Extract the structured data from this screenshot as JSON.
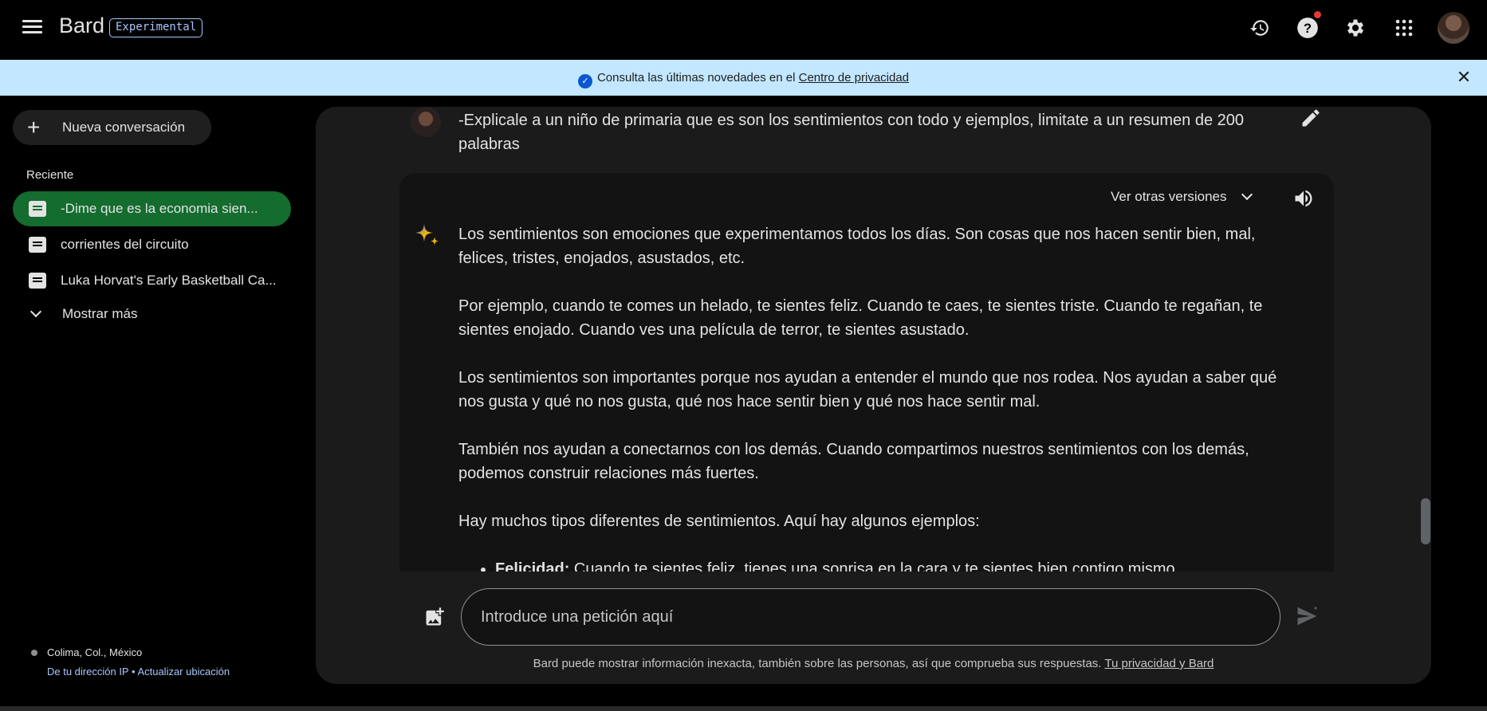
{
  "header": {
    "brand": "Bard",
    "badge": "Experimental",
    "icons": [
      "menu-icon",
      "history-icon",
      "help-icon",
      "settings-icon",
      "apps-icon",
      "avatar"
    ]
  },
  "banner": {
    "text": "Consulta las últimas novedades en el ",
    "link": "Centro de privacidad",
    "icons": [
      "verified-check-icon",
      "close-icon"
    ]
  },
  "sidebar": {
    "new_chat_label": "Nueva conversación",
    "recent_heading": "Reciente",
    "conversations": [
      {
        "title": "-Dime que es la economia sien...",
        "active": true
      },
      {
        "title": "corrientes del circuito",
        "active": false
      },
      {
        "title": "Luka Horvat's Early Basketball Ca...",
        "active": false
      }
    ],
    "show_more_label": "Mostrar más",
    "location": {
      "place": "Colima, Col., México",
      "ip_link": "De tu dirección IP",
      "separator": " • ",
      "update_link": "Actualizar ubicación"
    }
  },
  "chat": {
    "user_prompt": "-Explicale a un niño de primaria que es son los sentimientos con todo y ejemplos, limitate a un resumen de 200 palabras",
    "versions_label": "Ver otras versiones",
    "response": {
      "paragraphs": [
        "Los sentimientos son emociones que experimentamos todos los días. Son cosas que nos hacen sentir bien, mal, felices, tristes, enojados, asustados, etc.",
        "Por ejemplo, cuando te comes un helado, te sientes feliz. Cuando te caes, te sientes triste. Cuando te regañan, te sientes enojado. Cuando ves una película de terror, te sientes asustado.",
        "Los sentimientos son importantes porque nos ayudan a entender el mundo que nos rodea. Nos ayudan a saber qué nos gusta y qué no nos gusta, qué nos hace sentir bien y qué nos hace sentir mal.",
        "También nos ayudan a conectarnos con los demás. Cuando compartimos nuestros sentimientos con los demás, podemos construir relaciones más fuertes.",
        "Hay muchos tipos diferentes de sentimientos. Aquí hay algunos ejemplos:"
      ],
      "list": [
        {
          "term": "Felicidad:",
          "text": " Cuando te sientes feliz, tienes una sonrisa en la cara y te sientes bien contigo mismo."
        }
      ]
    }
  },
  "input": {
    "placeholder": "Introduce una petición aquí"
  },
  "disclaimer": {
    "text": "Bard puede mostrar información inexacta, también sobre las personas, así que comprueba sus respuestas. ",
    "link": "Tu privacidad y Bard"
  },
  "colors": {
    "banner_bg": "#c2e7ff",
    "active_conversation": "#146c2e",
    "accent_link": "#a8c7fa"
  }
}
